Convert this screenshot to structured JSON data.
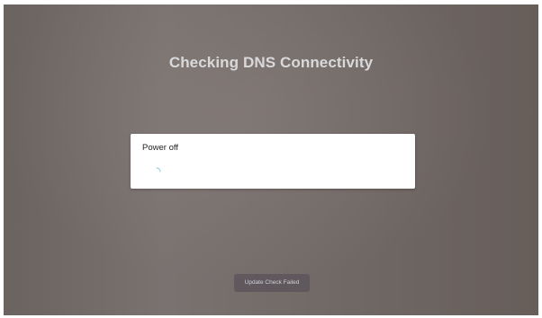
{
  "screen": {
    "title": "Checking DNS Connectivity"
  },
  "dialog": {
    "message": "Power off"
  },
  "toast": {
    "label": "Update Check Failed"
  },
  "colors": {
    "background": "#706865",
    "title_text": "#d9d9dc",
    "dialog_bg": "#ffffff",
    "toast_bg": "#5c565c",
    "spinner_accent": "#9ad0e8"
  },
  "icons": {
    "spinner": "loading-spinner-icon"
  }
}
